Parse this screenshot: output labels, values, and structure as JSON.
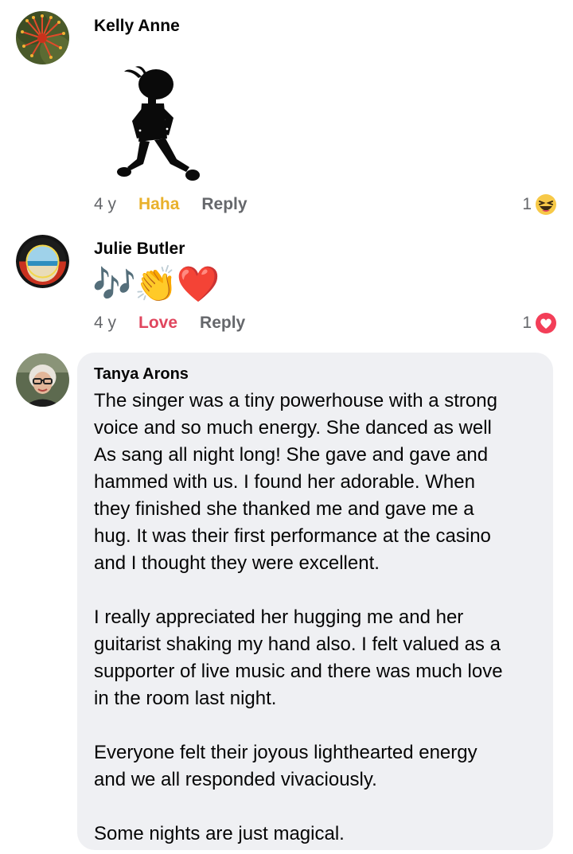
{
  "comments": [
    {
      "author": "Kelly Anne",
      "avatar_icon": "grevillea-flower-avatar",
      "sticker_icon": "dancing-figure-sticker",
      "time": "4 y",
      "reaction_label": "Haha",
      "reaction_color": "#e9b12b",
      "reply_label": "Reply",
      "reaction_count": "1",
      "reaction_icon": "haha-emoji-icon"
    },
    {
      "author": "Julie Butler",
      "avatar_icon": "beach-badge-avatar",
      "emoji_text": "🎶👏❤️",
      "time": "4 y",
      "reaction_label": "Love",
      "reaction_color": "#e0465e",
      "reply_label": "Reply",
      "reaction_count": "1",
      "reaction_icon": "love-heart-icon"
    },
    {
      "author": "Tanya Arons",
      "avatar_icon": "woman-glasses-avatar",
      "paragraphs": [
        "The singer was a tiny powerhouse with a strong\nvoice and so much energy.  She danced as well\nAs sang all night long!  She gave and gave and\nhammed with us.  I found her adorable.  When\nthey finished she thanked me and gave me a\nhug.  It was their first performance at the casino\nand I thought they were excellent.",
        "I really appreciated her  hugging me and her\nguitarist shaking my hand also.  I felt valued as a\nsupporter of live music and there was much love\nin the room last night.",
        "Everyone felt their joyous lighthearted energy\nand we all responded vivaciously.",
        "Some nights are just magical."
      ]
    }
  ]
}
